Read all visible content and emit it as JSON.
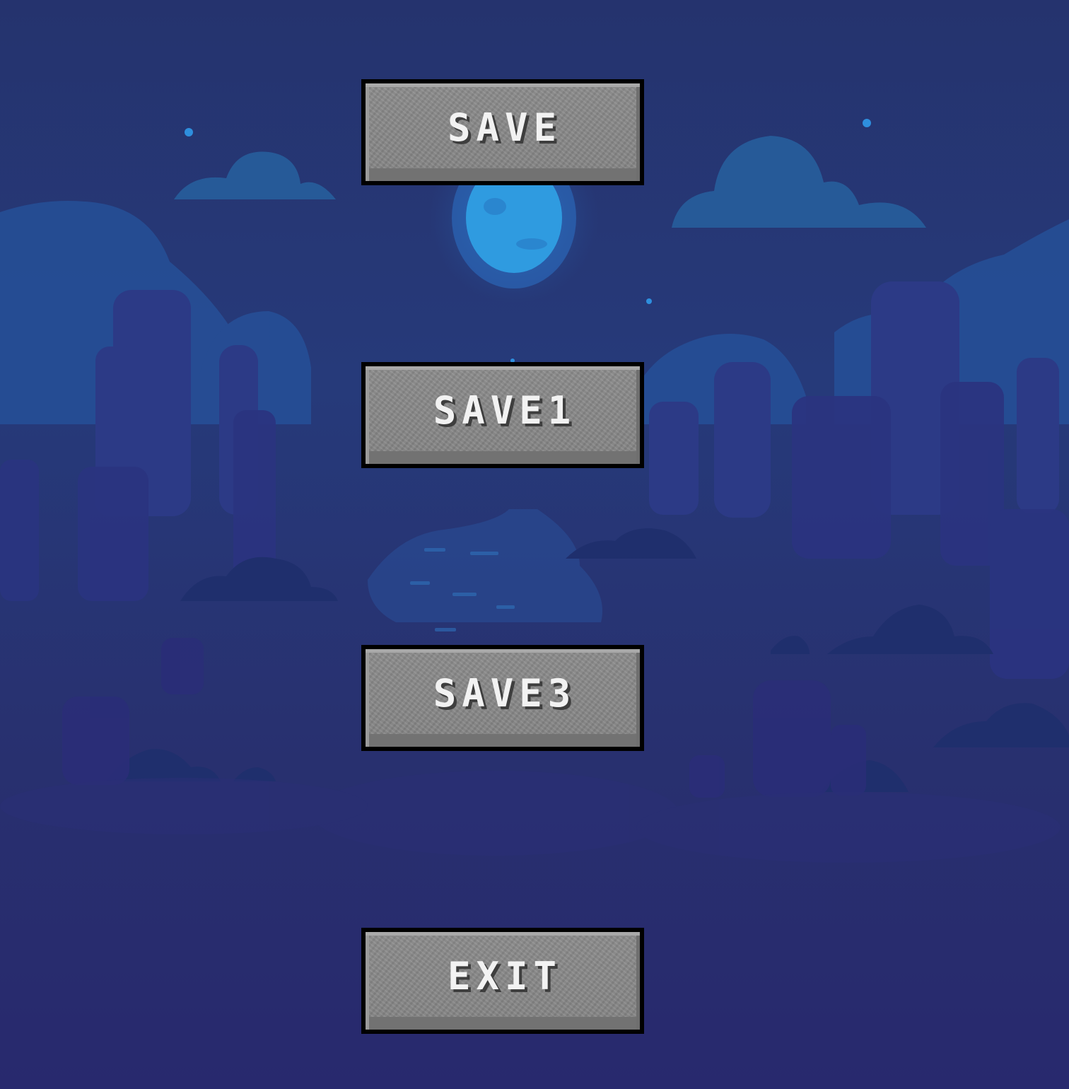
{
  "menu": {
    "buttons": [
      {
        "label": "SAVE"
      },
      {
        "label": "SAVE1"
      },
      {
        "label": "SAVE3"
      },
      {
        "label": "EXIT"
      }
    ]
  },
  "colors": {
    "sky_top": "#25336e",
    "sky_bottom": "#28296e",
    "moon": "#2f9be0",
    "star": "#2e8fde",
    "button_face": "#8a8a8a",
    "button_border": "#000000",
    "button_text": "#f2f2f2"
  }
}
